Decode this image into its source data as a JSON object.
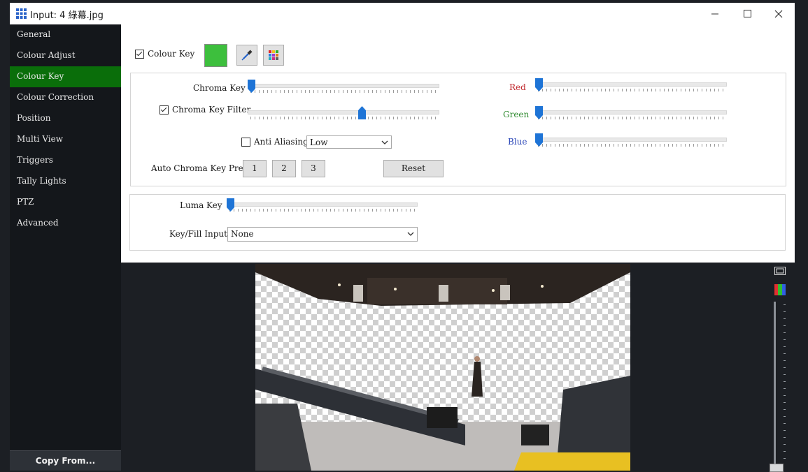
{
  "window": {
    "title": "Input: 4 綠幕.jpg"
  },
  "sidebar": {
    "items": [
      {
        "label": "General"
      },
      {
        "label": "Colour Adjust"
      },
      {
        "label": "Colour Key",
        "active": true
      },
      {
        "label": "Colour Correction"
      },
      {
        "label": "Position"
      },
      {
        "label": "Multi View"
      },
      {
        "label": "Triggers"
      },
      {
        "label": "Tally Lights"
      },
      {
        "label": "PTZ"
      },
      {
        "label": "Advanced"
      }
    ],
    "copy_from": "Copy From..."
  },
  "colour_key": {
    "enabled": true,
    "label": "Colour Key",
    "swatch_color": "#3dbf3d",
    "eyedropper_icon": "eyedropper-icon",
    "palette_icon": "palette-icon"
  },
  "chroma": {
    "chroma_key_label": "Chroma Key",
    "chroma_key_value": 0.0,
    "filter_label": "Chroma Key Filter",
    "filter_enabled": true,
    "filter_value": 0.6,
    "anti_aliasing_label": "Anti Aliasing",
    "anti_aliasing_enabled": false,
    "anti_aliasing_level": "Low",
    "presets_label": "Auto Chroma Key Presets",
    "presets": [
      "1",
      "2",
      "3"
    ],
    "reset_label": "Reset"
  },
  "rgb": {
    "red_label": "Red",
    "red_color": "#c0282d",
    "red_value": 0.0,
    "green_label": "Green",
    "green_color": "#2f8a2f",
    "green_value": 0.0,
    "blue_label": "Blue",
    "blue_color": "#2a46b8",
    "blue_value": 0.0
  },
  "luma": {
    "luma_key_label": "Luma Key",
    "luma_key_value": 0.0,
    "key_fill_label": "Key/Fill Input",
    "key_fill_value": "None"
  },
  "colors": {
    "accent_green": "#0a6e0a",
    "slider_thumb": "#1e74d6"
  }
}
